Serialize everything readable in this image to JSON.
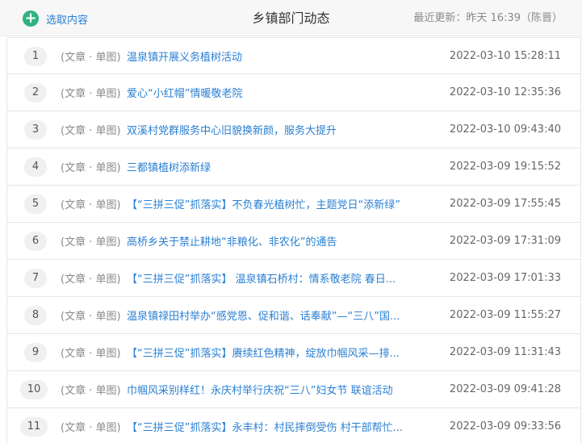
{
  "header": {
    "pick_label": "选取内容",
    "title": "乡镇部门动态",
    "updated": "最近更新：昨天 16:39（陈晋）"
  },
  "items": [
    {
      "num": "1",
      "type": "(文章 · 单图)",
      "title": "温泉镇开展义务植树活动",
      "time": "2022-03-10 15:28:11"
    },
    {
      "num": "2",
      "type": "(文章 · 单图)",
      "title": "爱心“小红帽”情暖敬老院",
      "time": "2022-03-10 12:35:36"
    },
    {
      "num": "3",
      "type": "(文章 · 单图)",
      "title": "双溪村党群服务中心旧貌换新颜，服务大提升",
      "time": "2022-03-10 09:43:40"
    },
    {
      "num": "4",
      "type": "(文章 · 单图)",
      "title": "三都镇植树添新绿",
      "time": "2022-03-09 19:15:52"
    },
    {
      "num": "5",
      "type": "(文章 · 单图)",
      "title": "【“三拼三促”抓落实】不负春光植树忙，主题党日“添新绿”",
      "time": "2022-03-09 17:55:45"
    },
    {
      "num": "6",
      "type": "(文章 · 单图)",
      "title": "高桥乡关于禁止耕地“非粮化、非农化”的通告",
      "time": "2022-03-09 17:31:09"
    },
    {
      "num": "7",
      "type": "(文章 · 单图)",
      "title": "【“三拼三促”抓落实】 温泉镇石桥村：情系敬老院 春日...",
      "time": "2022-03-09 17:01:33"
    },
    {
      "num": "8",
      "type": "(文章 · 单图)",
      "title": "温泉镇禄田村举办“感党恩、促和谐、话奉献”—“三八”国...",
      "time": "2022-03-09 11:55:27"
    },
    {
      "num": "9",
      "type": "(文章 · 单图)",
      "title": "【“三拼三促”抓落实】赓续红色精神，绽放巾帼风采—排...",
      "time": "2022-03-09 11:31:43"
    },
    {
      "num": "10",
      "type": "(文章 · 单图)",
      "title": "巾帼风采别样红！永庆村举行庆祝“三八”妇女节 联谊活动",
      "time": "2022-03-09 09:41:28"
    },
    {
      "num": "11",
      "type": "(文章 · 单图)",
      "title": "【“三拼三促”抓落实】永丰村：村民摔倒受伤 村干部帮忙...",
      "time": "2022-03-09 09:33:56"
    }
  ]
}
